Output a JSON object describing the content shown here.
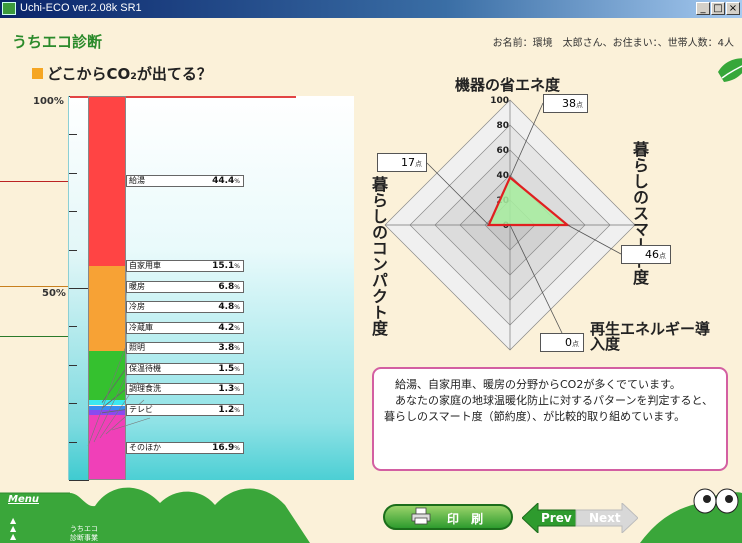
{
  "window": {
    "title": "Uchi-ECO ver.2.08k SR1",
    "minimize": "_",
    "maximize": "□",
    "close": "×"
  },
  "header": {
    "app_title": "うちエコ診断",
    "user_info": "お名前：環境　太郎さん、お住まい：、世帯人数：4人"
  },
  "section_title": "どこからCO₂が出てる？",
  "scale": {
    "top": "100%",
    "mid": "50%"
  },
  "chart_data": {
    "type": "bar",
    "stacked": true,
    "ylim": [
      0,
      100
    ],
    "categories": [
      "給湯",
      "自家用車",
      "暖房",
      "冷房",
      "冷蔵庫",
      "照明",
      "保温待機",
      "調理食洗",
      "テレビ",
      "そのほか"
    ],
    "values": [
      44.4,
      15.1,
      6.8,
      4.8,
      4.2,
      3.8,
      1.5,
      1.3,
      1.2,
      16.9
    ],
    "value_labels": [
      "44.4",
      "15.1",
      "6.8",
      "4.8",
      "4.2",
      "3.8",
      "1.5",
      "1.3",
      "1.2",
      "16.9"
    ],
    "unit": "%",
    "colors": [
      "#ff4444",
      "#f7a235",
      "#f7a235",
      "#35c12f",
      "#35c12f",
      "#35c12f",
      "#3de8f0",
      "#3a8cf0",
      "#8a4af0",
      "#f040b8"
    ]
  },
  "radar": {
    "axes": [
      {
        "label": "機器の省エネ度",
        "value": 38
      },
      {
        "label": "暮らしのスマート度",
        "value": 46
      },
      {
        "label": "再生エネルギー導入度",
        "value": 0
      },
      {
        "label": "暮らしのコンパクト度",
        "value": 17
      }
    ],
    "rmax": 100,
    "ticks": [
      "100",
      "80",
      "60",
      "40",
      "20",
      "0"
    ],
    "unit": "点",
    "line_color": "#e02020",
    "fill_color": "#a8f0a0"
  },
  "comment": {
    "line1": "　給湯、自家用車、暖房の分野からCO2が多くでています。",
    "line2": "　あなたの家庭の地球温暖化防止に対するパターンを判定すると、暮らしのスマート度（節約度）、が比較的取り組めています。"
  },
  "footer": {
    "menu": "Menu",
    "logo_line1": "うちエコ",
    "logo_line2": "診断事業",
    "print": "印 刷",
    "prev": "Prev",
    "next": "Next"
  }
}
